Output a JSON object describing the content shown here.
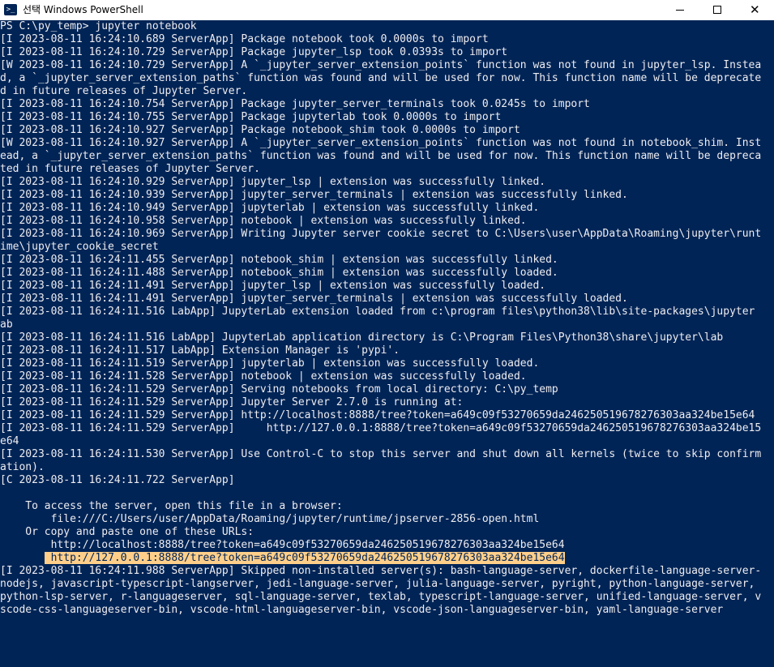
{
  "window": {
    "title": "선택 Windows PowerShell",
    "icon": "powershell-icon",
    "title_icon_text": ">_",
    "controls": {
      "minimize": "minimize-icon",
      "maximize": "maximize-icon",
      "close": "close-icon",
      "close_glyph": "✕"
    }
  },
  "colors": {
    "console_background": "#012456",
    "console_text": "#eeedf0",
    "selection_background": "#ffcf8a",
    "selection_text": "#012456",
    "titlebar_background": "#ffffff"
  },
  "console": {
    "lines": [
      {
        "text": "PS C:\\py_temp> jupyter notebook"
      },
      {
        "text": "[I 2023-08-11 16:24:10.689 ServerApp] Package notebook took 0.0000s to import"
      },
      {
        "text": "[I 2023-08-11 16:24:10.729 ServerApp] Package jupyter_lsp took 0.0393s to import"
      },
      {
        "text": "[W 2023-08-11 16:24:10.729 ServerApp] A `_jupyter_server_extension_points` function was not found in jupyter_lsp. Instea"
      },
      {
        "text": "d, a `_jupyter_server_extension_paths` function was found and will be used for now. This function name will be deprecate"
      },
      {
        "text": "d in future releases of Jupyter Server."
      },
      {
        "text": "[I 2023-08-11 16:24:10.754 ServerApp] Package jupyter_server_terminals took 0.0245s to import"
      },
      {
        "text": "[I 2023-08-11 16:24:10.755 ServerApp] Package jupyterlab took 0.0000s to import"
      },
      {
        "text": "[I 2023-08-11 16:24:10.927 ServerApp] Package notebook_shim took 0.0000s to import"
      },
      {
        "text": "[W 2023-08-11 16:24:10.927 ServerApp] A `_jupyter_server_extension_points` function was not found in notebook_shim. Inst"
      },
      {
        "text": "ead, a `_jupyter_server_extension_paths` function was found and will be used for now. This function name will be depreca"
      },
      {
        "text": "ted in future releases of Jupyter Server."
      },
      {
        "text": "[I 2023-08-11 16:24:10.929 ServerApp] jupyter_lsp | extension was successfully linked."
      },
      {
        "text": "[I 2023-08-11 16:24:10.939 ServerApp] jupyter_server_terminals | extension was successfully linked."
      },
      {
        "text": "[I 2023-08-11 16:24:10.949 ServerApp] jupyterlab | extension was successfully linked."
      },
      {
        "text": "[I 2023-08-11 16:24:10.958 ServerApp] notebook | extension was successfully linked."
      },
      {
        "text": "[I 2023-08-11 16:24:10.969 ServerApp] Writing Jupyter server cookie secret to C:\\Users\\user\\AppData\\Roaming\\jupyter\\runt"
      },
      {
        "text": "ime\\jupyter_cookie_secret"
      },
      {
        "text": "[I 2023-08-11 16:24:11.455 ServerApp] notebook_shim | extension was successfully linked."
      },
      {
        "text": "[I 2023-08-11 16:24:11.488 ServerApp] notebook_shim | extension was successfully loaded."
      },
      {
        "text": "[I 2023-08-11 16:24:11.491 ServerApp] jupyter_lsp | extension was successfully loaded."
      },
      {
        "text": "[I 2023-08-11 16:24:11.491 ServerApp] jupyter_server_terminals | extension was successfully loaded."
      },
      {
        "text": "[I 2023-08-11 16:24:11.516 LabApp] JupyterLab extension loaded from c:\\program files\\python38\\lib\\site-packages\\jupyter"
      },
      {
        "text": "ab"
      },
      {
        "text": "[I 2023-08-11 16:24:11.516 LabApp] JupyterLab application directory is C:\\Program Files\\Python38\\share\\jupyter\\lab"
      },
      {
        "text": "[I 2023-08-11 16:24:11.517 LabApp] Extension Manager is 'pypi'."
      },
      {
        "text": "[I 2023-08-11 16:24:11.519 ServerApp] jupyterlab | extension was successfully loaded."
      },
      {
        "text": "[I 2023-08-11 16:24:11.528 ServerApp] notebook | extension was successfully loaded."
      },
      {
        "text": "[I 2023-08-11 16:24:11.529 ServerApp] Serving notebooks from local directory: C:\\py_temp"
      },
      {
        "text": "[I 2023-08-11 16:24:11.529 ServerApp] Jupyter Server 2.7.0 is running at:"
      },
      {
        "text": "[I 2023-08-11 16:24:11.529 ServerApp] http://localhost:8888/tree?token=a649c09f53270659da246250519678276303aa324be15e64"
      },
      {
        "text": "[I 2023-08-11 16:24:11.529 ServerApp]     http://127.0.0.1:8888/tree?token=a649c09f53270659da246250519678276303aa324be15"
      },
      {
        "text": "e64"
      },
      {
        "text": "[I 2023-08-11 16:24:11.530 ServerApp] Use Control-C to stop this server and shut down all kernels (twice to skip confirm"
      },
      {
        "text": "ation)."
      },
      {
        "text": "[C 2023-08-11 16:24:11.722 ServerApp]"
      },
      {
        "text": ""
      },
      {
        "text": "    To access the server, open this file in a browser:"
      },
      {
        "text": "        file:///C:/Users/user/AppData/Roaming/jupyter/runtime/jpserver-2856-open.html"
      },
      {
        "text": "    Or copy and paste one of these URLs:"
      },
      {
        "text": "        http://localhost:8888/tree?token=a649c09f53270659da246250519678276303aa324be15e64"
      },
      {
        "prefix": "       ",
        "highlight": " http://127.0.0.1:8888/tree?token=a649c09f53270659da246250519678276303aa324be15e64"
      },
      {
        "text": "[I 2023-08-11 16:24:11.988 ServerApp] Skipped non-installed server(s): bash-language-server, dockerfile-language-server-"
      },
      {
        "text": "nodejs, javascript-typescript-langserver, jedi-language-server, julia-language-server, pyright, python-language-server,"
      },
      {
        "text": "python-lsp-server, r-languageserver, sql-language-server, texlab, typescript-language-server, unified-language-server, v"
      },
      {
        "text": "scode-css-languageserver-bin, vscode-html-languageserver-bin, vscode-json-languageserver-bin, yaml-language-server"
      }
    ]
  }
}
